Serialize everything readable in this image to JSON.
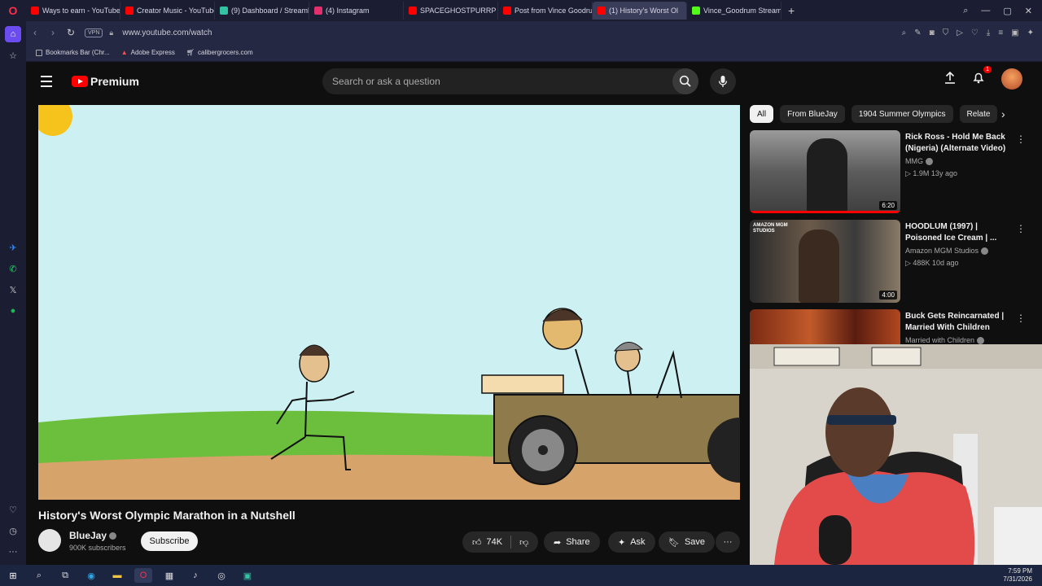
{
  "browser": {
    "tabs": [
      {
        "label": "Ways to earn - YouTube St",
        "color": "#ff0000"
      },
      {
        "label": "Creator Music - YouTube S",
        "color": "#ff0000"
      },
      {
        "label": "(9) Dashboard / Streamlab",
        "color": "#31c3a2"
      },
      {
        "label": "(4) Instagram",
        "color": "#e1306c"
      },
      {
        "label": "SPACEGHOSTPURRP & DC",
        "color": "#ff0000"
      },
      {
        "label": "Post from Vince Goodrum",
        "color": "#ff0000"
      },
      {
        "label": "(1) History's Worst Ol",
        "color": "#ff0000",
        "active": true
      },
      {
        "label": "Vince_Goodrum Stream -",
        "color": "#53fc18"
      }
    ],
    "vpn_label": "VPN",
    "url": "www.youtube.com/watch",
    "bookmarks": [
      "Bookmarks Bar (Chr...",
      "Adobe Express",
      "calibergrocers.com"
    ]
  },
  "youtube": {
    "brand": "Premium",
    "search_placeholder": "Search or ask a question",
    "notification_count": "1",
    "video": {
      "title": "History's Worst Olympic Marathon in a Nutshell",
      "channel": "BlueJay",
      "subscribers": "900K subscribers",
      "subscribe_label": "Subscribe",
      "likes": "74K",
      "share_label": "Share",
      "ask_label": "Ask",
      "save_label": "Save"
    },
    "chips": [
      "All",
      "From BlueJay",
      "1904 Summer Olympics",
      "Relate"
    ],
    "recommendations": [
      {
        "title": "Rick Ross - Hold Me Back (Nigeria) (Alternate Video)",
        "channel": "MMG",
        "meta": "1.9M  13y ago",
        "duration": "6:20"
      },
      {
        "title": "HOODLUM (1997) | Poisoned Ice Cream | ...",
        "channel": "Amazon MGM Studios",
        "meta": "488K  10d ago",
        "duration": "4:00",
        "thumb_text": "AMAZON MGM STUDIOS"
      },
      {
        "title": "Buck Gets Reincarnated | Married With Children",
        "channel": "Married with Children",
        "meta": "",
        "duration": ""
      }
    ]
  },
  "taskbar": {
    "time": "7:59 PM",
    "date": "7/31/2026"
  }
}
